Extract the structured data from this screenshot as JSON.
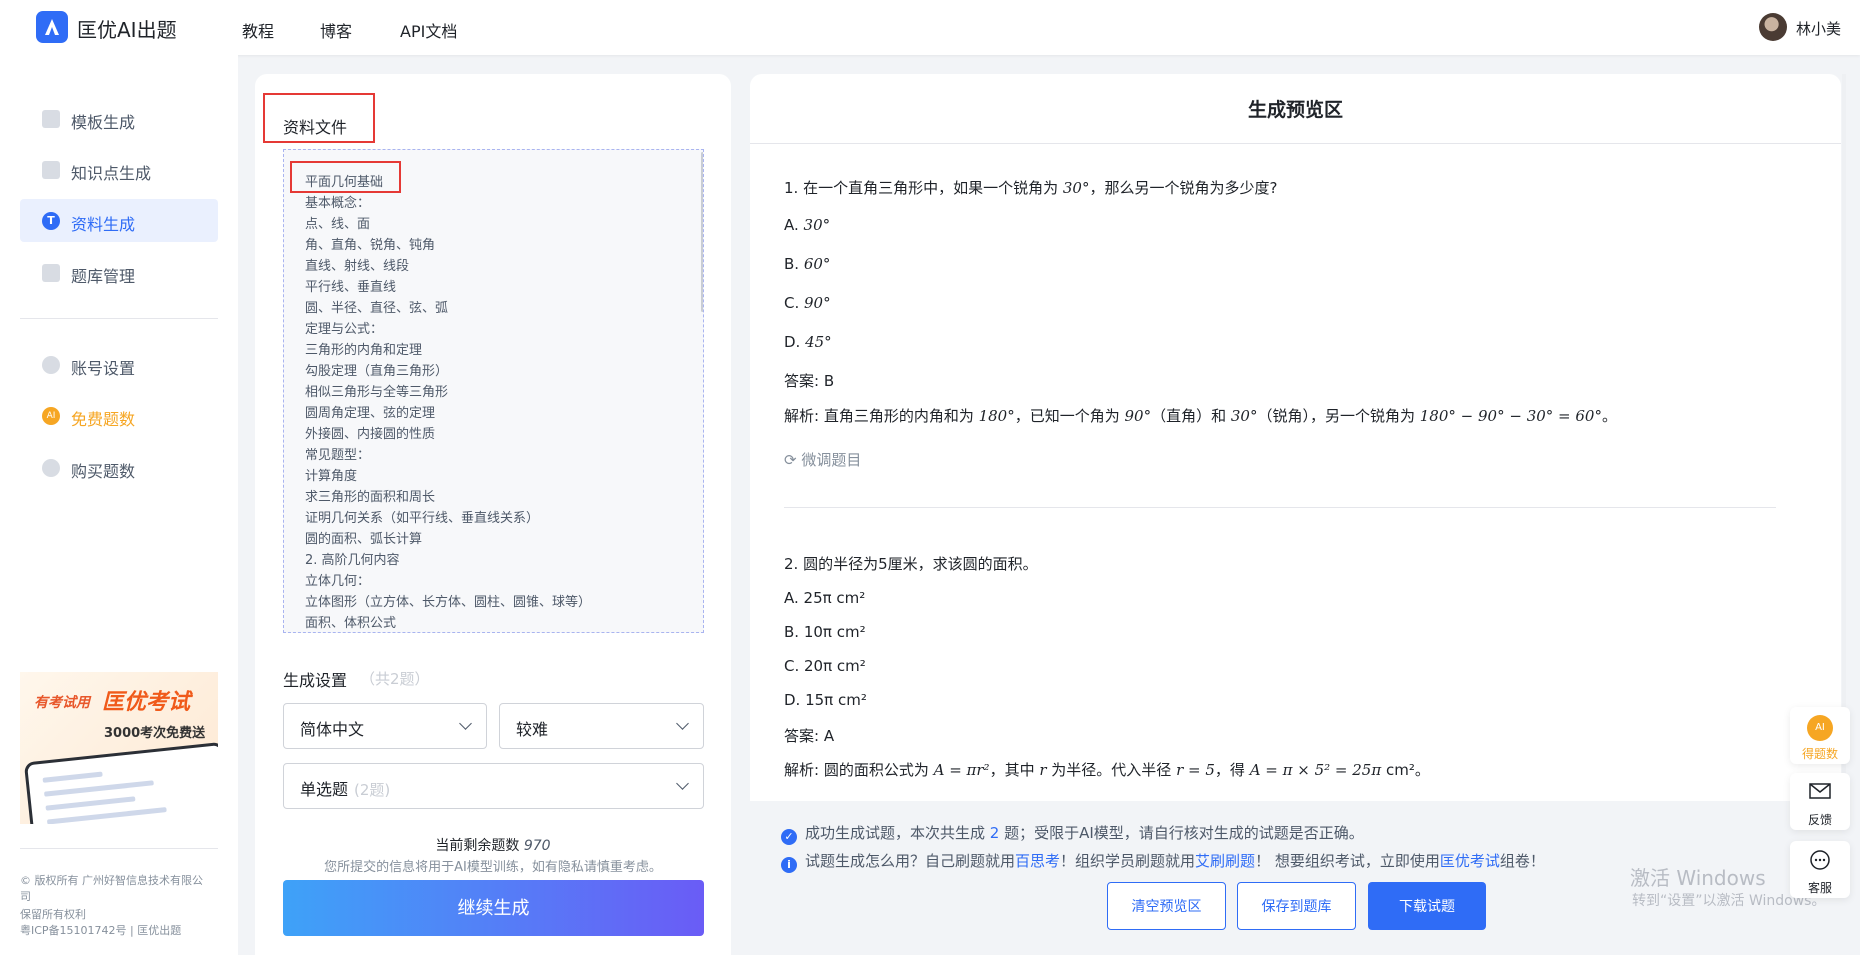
{
  "header": {
    "brand": "匡优AI出题",
    "nav": [
      "教程",
      "博客",
      "API文档"
    ],
    "username": "林小美"
  },
  "sidebar": {
    "items": [
      {
        "label": "模板生成"
      },
      {
        "label": "知识点生成"
      },
      {
        "label": "资料生成"
      },
      {
        "label": "题库管理"
      }
    ],
    "items2": [
      {
        "label": "账号设置"
      },
      {
        "label": "免费题数"
      },
      {
        "label": "购买题数"
      }
    ],
    "promo": {
      "line1": "有考试用",
      "line2": "匡优考试",
      "line3": "3000考次免费送"
    },
    "footer": [
      "© 版权所有 广州好智信息技术有限公",
      "司",
      "保留所有权利",
      "粤ICP备15101742号 | 匡优出题"
    ]
  },
  "material": {
    "title": "资料文件",
    "lines": [
      "平面几何基础",
      "基本概念：",
      "点、线、面",
      "角、直角、锐角、钝角",
      "直线、射线、线段",
      "平行线、垂直线",
      "圆、半径、直径、弦、弧",
      "定理与公式：",
      "三角形的内角和定理",
      "勾股定理（直角三角形）",
      "相似三角形与全等三角形",
      "圆周角定理、弦的定理",
      "外接圆、内接圆的性质",
      "常见题型：",
      "计算角度",
      "求三角形的面积和周长",
      "证明几何关系（如平行线、垂直线关系）",
      "圆的面积、弧长计算",
      "2. 高阶几何内容",
      "立体几何：",
      "立体图形（立方体、长方体、圆柱、圆锥、球等）",
      "面积、体积公式"
    ]
  },
  "settings": {
    "label": "生成设置",
    "count": "（共2题）",
    "language": "简体中文",
    "difficulty": "较难",
    "type": "单选题",
    "type_count": "(2题)",
    "remain_label": "当前剩余题数",
    "remain_value": "970",
    "privacy": "您所提交的信息将用于AI模型训练，如有隐私请慎重考虑。",
    "generate": "继续生成"
  },
  "preview": {
    "title": "生成预览区",
    "q1": {
      "stem_a": "1. 在一个直角三角形中，如果一个锐角为 ",
      "stem_m": "30°",
      "stem_b": "，那么另一个锐角为多少度?",
      "options": [
        {
          "label": "A. ",
          "value": "30°"
        },
        {
          "label": "B. ",
          "value": "60°"
        },
        {
          "label": "C. ",
          "value": "90°"
        },
        {
          "label": "D. ",
          "value": "45°"
        }
      ],
      "answer": "答案: B",
      "ex_a": "解析: 直角三角形的内角和为 ",
      "ex_m1": "180°",
      "ex_b": "，已知一个角为 ",
      "ex_m2": "90°",
      "ex_c": "（直角）和 ",
      "ex_m3": "30°",
      "ex_d": "（锐角），另一个锐角为 ",
      "ex_m4": "180° − 90° − 30° = 60°",
      "ex_e": "。"
    },
    "tune": "微调题目",
    "q2": {
      "stem": "2. 圆的半径为5厘米，求该圆的面积。",
      "options": [
        "A. 25π cm²",
        "B. 10π cm²",
        "C. 20π cm²",
        "D. 15π cm²"
      ],
      "answer": "答案: A",
      "ex_a": "解析: 圆的面积公式为 ",
      "ex_m1": "A = πr²",
      "ex_b": "，其中 ",
      "ex_m2": "r",
      "ex_c": " 为半径。代入半径 ",
      "ex_m3": "r = 5",
      "ex_d": "，得 ",
      "ex_m4": "A = π × 5² = 25π",
      "ex_e": " cm²。"
    }
  },
  "notice": {
    "success_a": "成功生成试题，本次共生成 ",
    "success_n": "2",
    "success_b": " 题；受限于AI模型，请自行核对生成的试题是否正确。",
    "tip_a": "试题生成怎么用？自己刷题就用",
    "tip_l1": "百思考",
    "tip_b": "！组织学员刷题就用",
    "tip_l2": "艾刷刷题",
    "tip_c": "！ 想要组织考试，立即使用",
    "tip_l3": "匡优考试",
    "tip_d": "组卷！"
  },
  "actions": {
    "clear": "清空预览区",
    "save": "保存到题库",
    "download": "下载试题"
  },
  "floating": {
    "ai_badge": "AI",
    "get": "得题数",
    "feedback": "反馈",
    "service": "客服"
  },
  "watermark": {
    "line1": "激活 Windows",
    "line2": "转到“设置”以激活 Windows。"
  },
  "colors": {
    "accent": "#2f6cf6",
    "orange": "#f6a623",
    "highlight_red": "#e53935"
  }
}
